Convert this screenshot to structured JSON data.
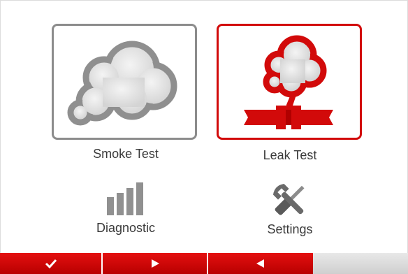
{
  "tiles": {
    "smoke": {
      "label": "Smoke Test",
      "icon": "smoke-cloud-icon"
    },
    "leak": {
      "label": "Leak Test",
      "icon": "leak-pipe-icon"
    }
  },
  "menu": {
    "diagnostic": {
      "label": "Diagnostic",
      "icon": "signal-bars-icon"
    },
    "settings": {
      "label": "Settings",
      "icon": "wrench-screwdriver-icon"
    }
  },
  "footer": {
    "buttons": [
      {
        "icon": "check-icon"
      },
      {
        "icon": "play-right-icon"
      },
      {
        "icon": "play-left-icon"
      }
    ]
  },
  "colors": {
    "accent": "#d20a0a",
    "neutral_border": "#8c8c8c",
    "cloud_fill": "#e6e6e6",
    "cloud_outline": "#8f8f8f",
    "icon_gray": "#909090"
  }
}
